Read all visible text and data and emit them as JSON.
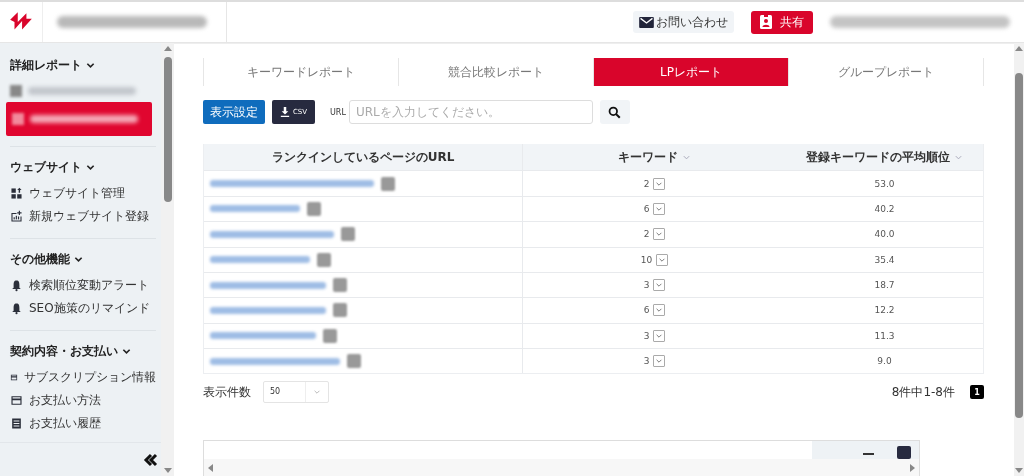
{
  "header": {
    "contact_button": "お問い合わせ",
    "share_button": "共有"
  },
  "sidebar": {
    "sections": [
      {
        "title": "詳細レポート",
        "expanded": true,
        "items": [
          {
            "kind": "site",
            "selected": false
          },
          {
            "kind": "site",
            "selected": true
          }
        ]
      },
      {
        "title": "ウェブサイト",
        "expanded": true,
        "items": [
          {
            "kind": "grid",
            "label": "ウェブサイト管理",
            "selected": false
          },
          {
            "kind": "chart",
            "label": "新規ウェブサイト登録",
            "selected": false
          }
        ]
      },
      {
        "title": "その他機能",
        "expanded": true,
        "items": [
          {
            "kind": "bell",
            "label": "検索順位変動アラート",
            "selected": false
          },
          {
            "kind": "bell",
            "label": "SEO施策のリマインド",
            "selected": false
          }
        ]
      },
      {
        "title": "契約内容・お支払い",
        "expanded": true,
        "items": [
          {
            "kind": "card",
            "label": "サブスクリプション情報",
            "selected": false
          },
          {
            "kind": "card",
            "label": "お支払い方法",
            "selected": false
          },
          {
            "kind": "receipt",
            "label": "お支払い履歴",
            "selected": false
          }
        ]
      }
    ]
  },
  "tabs": [
    {
      "label": "キーワードレポート",
      "selected": false
    },
    {
      "label": "競合比較レポート",
      "selected": false
    },
    {
      "label": "LPレポート",
      "selected": true
    },
    {
      "label": "グループレポート",
      "selected": false
    }
  ],
  "toolbar": {
    "settings_button": "表示設定",
    "csv_button": "CSV",
    "url_label": "URL",
    "url_field": {
      "placeholder": "URLを入力してください。"
    }
  },
  "table": {
    "columns": [
      "ランクインしているページのURL",
      "キーワード",
      "登録キーワードの平均順位"
    ],
    "rows": [
      {
        "keywords": "2",
        "average_rank": "53.0"
      },
      {
        "keywords": "6",
        "average_rank": "40.2"
      },
      {
        "keywords": "2",
        "average_rank": "40.0"
      },
      {
        "keywords": "10",
        "average_rank": "35.4"
      },
      {
        "keywords": "3",
        "average_rank": "18.7"
      },
      {
        "keywords": "6",
        "average_rank": "12.2"
      },
      {
        "keywords": "3",
        "average_rank": "11.3"
      },
      {
        "keywords": "3",
        "average_rank": "9.0"
      }
    ]
  },
  "pagination": {
    "page_size_label": "表示件数",
    "page_size": "50",
    "summary": "8件中1-8件",
    "pages": [
      {
        "label": "1",
        "selected": true
      }
    ]
  }
}
